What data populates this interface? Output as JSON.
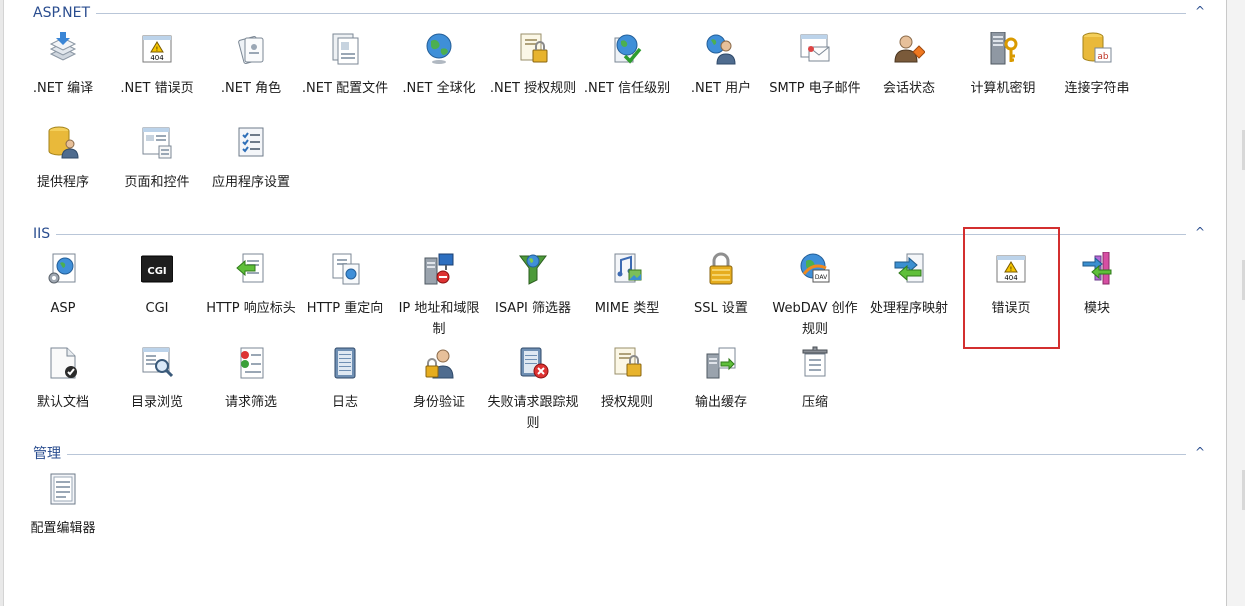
{
  "sections": [
    {
      "title": "ASP.NET",
      "items": [
        {
          "label": ".NET 编译",
          "icon": "dotnet-compile-icon"
        },
        {
          "label": ".NET 错误页",
          "icon": "error-404-icon"
        },
        {
          "label": ".NET 角色",
          "icon": "roles-icon"
        },
        {
          "label": ".NET 配置文件",
          "icon": "profile-icon"
        },
        {
          "label": ".NET 全球化",
          "icon": "globe-icon"
        },
        {
          "label": ".NET 授权规则",
          "icon": "auth-rules-icon"
        },
        {
          "label": ".NET 信任级别",
          "icon": "trust-level-icon"
        },
        {
          "label": ".NET 用户",
          "icon": "users-icon"
        },
        {
          "label": "SMTP 电子邮件",
          "icon": "smtp-email-icon"
        },
        {
          "label": "会话状态",
          "icon": "session-state-icon"
        },
        {
          "label": "计算机密钥",
          "icon": "machine-key-icon"
        },
        {
          "label": "连接字符串",
          "icon": "connection-string-icon"
        },
        {
          "label": "提供程序",
          "icon": "providers-icon"
        },
        {
          "label": "页面和控件",
          "icon": "pages-controls-icon"
        },
        {
          "label": "应用程序设置",
          "icon": "app-settings-icon"
        }
      ]
    },
    {
      "title": "IIS",
      "items": [
        {
          "label": "ASP",
          "icon": "asp-icon"
        },
        {
          "label": "CGI",
          "icon": "cgi-icon",
          "badge": "CGI"
        },
        {
          "label": "HTTP 响应标头",
          "icon": "http-headers-icon"
        },
        {
          "label": "HTTP 重定向",
          "icon": "http-redirect-icon"
        },
        {
          "label": "IP 地址和域限制",
          "icon": "ip-restrictions-icon"
        },
        {
          "label": "ISAPI 筛选器",
          "icon": "isapi-filter-icon"
        },
        {
          "label": "MIME 类型",
          "icon": "mime-types-icon"
        },
        {
          "label": "SSL 设置",
          "icon": "ssl-lock-icon"
        },
        {
          "label": "WebDAV 创作规则",
          "icon": "webdav-icon",
          "badge": "DAV"
        },
        {
          "label": "处理程序映射",
          "icon": "handler-mappings-icon"
        },
        {
          "label": "错误页",
          "icon": "error-pages-icon"
        },
        {
          "label": "模块",
          "icon": "modules-icon"
        },
        {
          "label": "默认文档",
          "icon": "default-document-icon"
        },
        {
          "label": "目录浏览",
          "icon": "directory-browsing-icon"
        },
        {
          "label": "请求筛选",
          "icon": "request-filtering-icon"
        },
        {
          "label": "日志",
          "icon": "logging-icon"
        },
        {
          "label": "身份验证",
          "icon": "authentication-icon"
        },
        {
          "label": "失败请求跟踪规则",
          "icon": "failed-request-tracing-icon"
        },
        {
          "label": "授权规则",
          "icon": "authorization-rules-icon"
        },
        {
          "label": "输出缓存",
          "icon": "output-caching-icon"
        },
        {
          "label": "压缩",
          "icon": "compression-icon"
        }
      ]
    },
    {
      "title": "管理",
      "items": [
        {
          "label": "配置编辑器",
          "icon": "configuration-editor-icon"
        }
      ]
    }
  ],
  "error_badge_text": "404",
  "collapse_glyph": "^",
  "colors": {
    "section_title": "#2a4d8f",
    "divider": "#b9c6d8",
    "highlight": "#d32f2f"
  }
}
